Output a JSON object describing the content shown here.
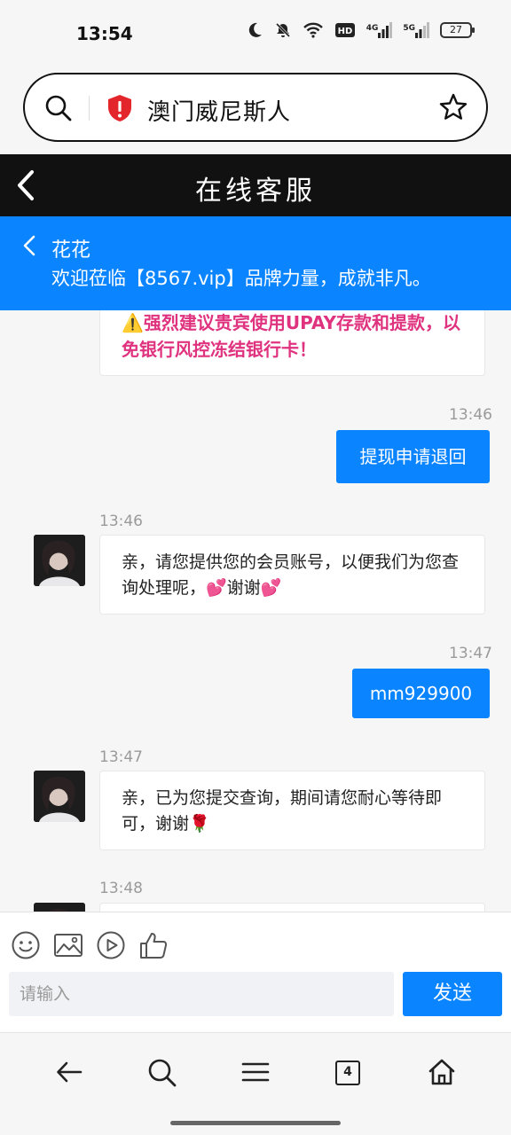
{
  "status_bar": {
    "time": "13:54",
    "battery": "27",
    "net_4g": "4G",
    "net_5g": "5G",
    "hd": "HD"
  },
  "browser": {
    "address_text": "澳门威尼斯人"
  },
  "title_bar": {
    "title": "在线客服"
  },
  "agent": {
    "name": "花花",
    "welcome": "欢迎莅临【8567.vip】品牌力量，成就非凡。"
  },
  "messages": {
    "notice": "⚠️强烈建议贵宾使用UPAY存款和提款，以免银行风控冻结银行卡！",
    "m1": {
      "time": "13:46",
      "text": "提现申请退回"
    },
    "m2": {
      "time": "13:46",
      "text": "亲，请您提供您的会员账号，以便我们为您查询处理呢，💕谢谢💕"
    },
    "m3": {
      "time": "13:47",
      "text": "mm929900"
    },
    "m4": {
      "time": "13:47",
      "text": "亲，已为您提交查询，期间请您耐心等待即可，谢谢🌹"
    },
    "m5": {
      "time": "13:48"
    }
  },
  "input": {
    "placeholder": "请输入",
    "send_label": "发送"
  },
  "nav": {
    "tab_count": "4"
  },
  "colors": {
    "accent": "#0a84ff",
    "warning_text": "#e0337f",
    "title_bar": "#111111"
  }
}
